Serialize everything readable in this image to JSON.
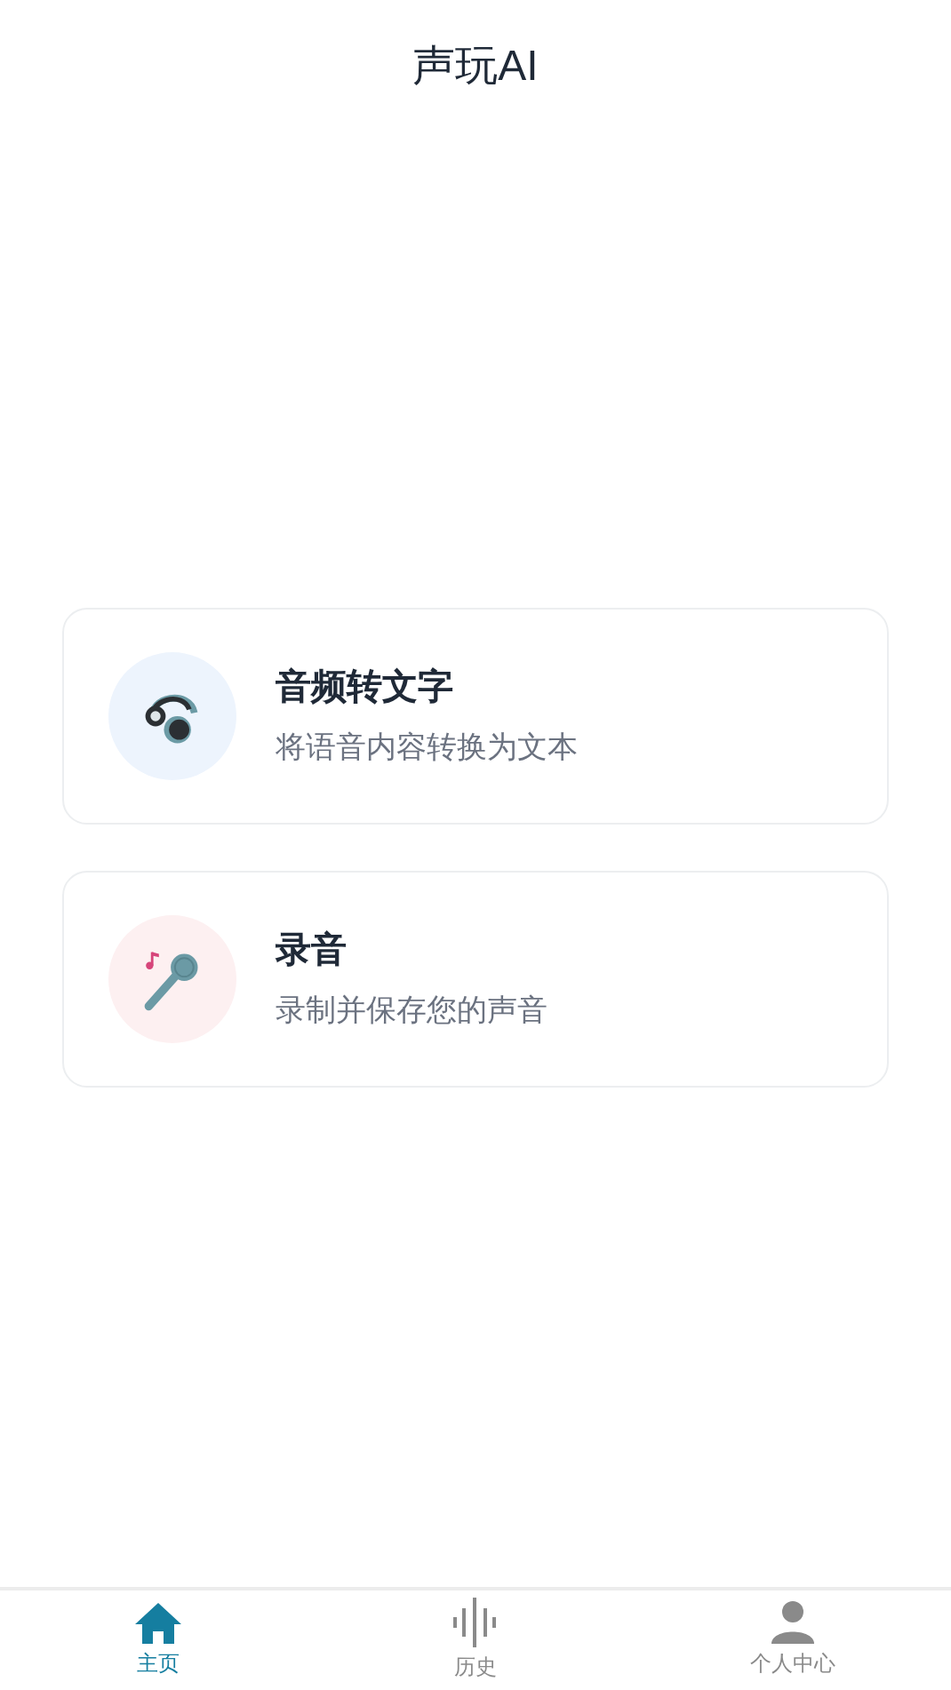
{
  "header": {
    "title": "声玩AI"
  },
  "features": [
    {
      "kind": "headphones",
      "title": "音频转文字",
      "subtitle": "将语音内容转换为文本",
      "color": "#edf4fd"
    },
    {
      "kind": "microphone",
      "title": "录音",
      "subtitle": "录制并保存您的声音",
      "color": "#fdf0f1"
    }
  ],
  "tabs": [
    {
      "kind": "home",
      "label": "主页",
      "selected": true
    },
    {
      "kind": "history",
      "label": "历史",
      "selected": false
    },
    {
      "kind": "profile",
      "label": "个人中心",
      "selected": false
    }
  ]
}
